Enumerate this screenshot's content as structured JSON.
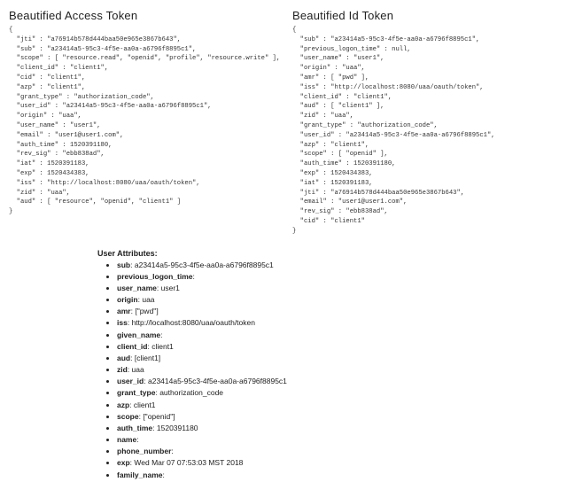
{
  "access": {
    "heading": "Beautified Access Token",
    "json": "{\n  \"jti\" : \"a76914b578d444baa50e965e3867b643\",\n  \"sub\" : \"a23414a5-95c3-4f5e-aa0a-a6796f8895c1\",\n  \"scope\" : [ \"resource.read\", \"openid\", \"profile\", \"resource.write\" ],\n  \"client_id\" : \"client1\",\n  \"cid\" : \"client1\",\n  \"azp\" : \"client1\",\n  \"grant_type\" : \"authorization_code\",\n  \"user_id\" : \"a23414a5-95c3-4f5e-aa0a-a6796f8895c1\",\n  \"origin\" : \"uaa\",\n  \"user_name\" : \"user1\",\n  \"email\" : \"user1@user1.com\",\n  \"auth_time\" : 1520391180,\n  \"rev_sig\" : \"ebb838ad\",\n  \"iat\" : 1520391183,\n  \"exp\" : 1520434383,\n  \"iss\" : \"http://localhost:8080/uaa/oauth/token\",\n  \"zid\" : \"uaa\",\n  \"aud\" : [ \"resource\", \"openid\", \"client1\" ]\n}"
  },
  "id": {
    "heading": "Beautified Id Token",
    "json": "{\n  \"sub\" : \"a23414a5-95c3-4f5e-aa0a-a6796f8895c1\",\n  \"previous_logon_time\" : null,\n  \"user_name\" : \"user1\",\n  \"origin\" : \"uaa\",\n  \"amr\" : [ \"pwd\" ],\n  \"iss\" : \"http://localhost:8080/uaa/oauth/token\",\n  \"client_id\" : \"client1\",\n  \"aud\" : [ \"client1\" ],\n  \"zid\" : \"uaa\",\n  \"grant_type\" : \"authorization_code\",\n  \"user_id\" : \"a23414a5-95c3-4f5e-aa0a-a6796f8895c1\",\n  \"azp\" : \"client1\",\n  \"scope\" : [ \"openid\" ],\n  \"auth_time\" : 1520391180,\n  \"exp\" : 1520434383,\n  \"iat\" : 1520391183,\n  \"jti\" : \"a76914b578d444baa50e965e3867b643\",\n  \"email\" : \"user1@user1.com\",\n  \"rev_sig\" : \"ebb838ad\",\n  \"cid\" : \"client1\"\n}"
  },
  "attrs": {
    "heading": "User Attributes:",
    "items": [
      {
        "k": "sub",
        "v": "a23414a5-95c3-4f5e-aa0a-a6796f8895c1"
      },
      {
        "k": "previous_logon_time",
        "v": ""
      },
      {
        "k": "user_name",
        "v": "user1"
      },
      {
        "k": "origin",
        "v": "uaa"
      },
      {
        "k": "amr",
        "v": "[\"pwd\"]"
      },
      {
        "k": "iss",
        "v": "http://localhost:8080/uaa/oauth/token"
      },
      {
        "k": "given_name",
        "v": ""
      },
      {
        "k": "client_id",
        "v": "client1"
      },
      {
        "k": "aud",
        "v": "[client1]"
      },
      {
        "k": "zid",
        "v": "uaa"
      },
      {
        "k": "user_id",
        "v": "a23414a5-95c3-4f5e-aa0a-a6796f8895c1"
      },
      {
        "k": "grant_type",
        "v": "authorization_code"
      },
      {
        "k": "azp",
        "v": "client1"
      },
      {
        "k": "scope",
        "v": "[\"openid\"]"
      },
      {
        "k": "auth_time",
        "v": "1520391180"
      },
      {
        "k": "name",
        "v": ""
      },
      {
        "k": "phone_number",
        "v": ""
      },
      {
        "k": "exp",
        "v": "Wed Mar 07 07:53:03 MST 2018"
      },
      {
        "k": "family_name",
        "v": ""
      }
    ]
  }
}
